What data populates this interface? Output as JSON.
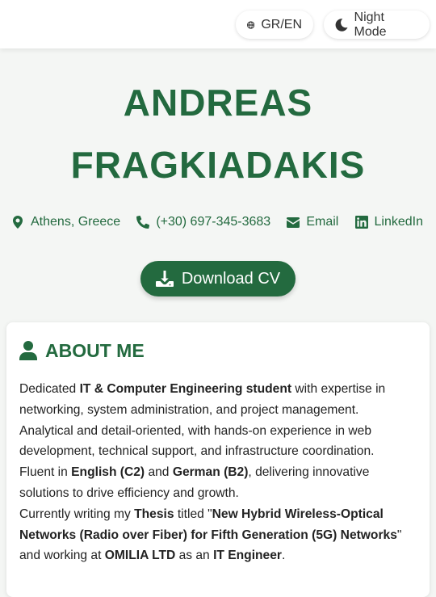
{
  "header": {
    "lang_label": "GR/EN",
    "night_label": "Night Mode"
  },
  "hero": {
    "name_line1": "ANDREAS",
    "name_line2": "FRAGKIADAKIS",
    "contacts": {
      "location": "Athens, Greece",
      "phone": "(+30) 697-345-3683",
      "email": "Email",
      "linkedin": "LinkedIn"
    },
    "download_label": "Download CV"
  },
  "about": {
    "title": "ABOUT ME",
    "p1": {
      "t1": "Dedicated ",
      "b1": "IT & Computer Engineering student",
      "t2": " with expertise in networking, system administration, and project management."
    },
    "p2": "Analytical and detail-oriented, with hands-on experience in web development, technical support, and infrastructure coordination.",
    "p3": {
      "t1": "Fluent in ",
      "b1": "English (C2)",
      "t2": " and ",
      "b2": "German (B2)",
      "t3": ", delivering innovative solutions to drive efficiency and growth."
    },
    "p4": {
      "t1": "Currently writing my ",
      "b1": "Thesis",
      "t2": " titled \"",
      "b2": "New Hybrid Wireless-Optical Networks (Radio over Fiber) for Fifth Generation (5G) Networks",
      "t3": "\" and working at ",
      "b3": "OMILIA LTD",
      "t4": " as an ",
      "b4": "IT Engineer",
      "t5": "."
    }
  },
  "colors": {
    "accent": "#236a3f",
    "background": "#f4f6f4"
  },
  "icons": {
    "lang": "globe-icon",
    "night": "moon-icon",
    "location": "map-marker-icon",
    "phone": "phone-icon",
    "email": "envelope-icon",
    "linkedin": "linkedin-icon",
    "download": "download-icon",
    "about": "user-icon"
  }
}
